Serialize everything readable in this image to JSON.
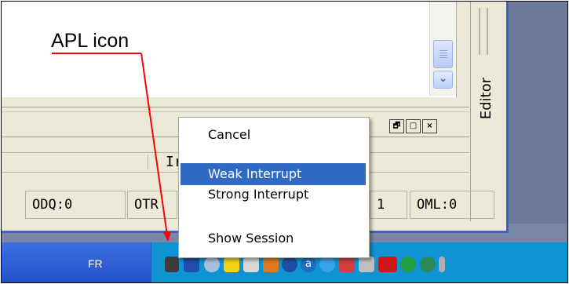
{
  "annotation": {
    "label": "APL icon",
    "color": "#ff0000"
  },
  "editor_tab": {
    "label": "Editor"
  },
  "pane_buttons": [
    "🗗",
    "□",
    "×"
  ],
  "input_row": {
    "text": "Ir"
  },
  "status_cells": [
    "ODQ:0",
    "OTR",
    "1",
    "OML:0"
  ],
  "context_menu": {
    "items": [
      {
        "label": "Cancel",
        "highlighted": false
      },
      {
        "label": "Weak Interrupt",
        "highlighted": true
      },
      {
        "label": "Strong Interrupt",
        "highlighted": false
      },
      {
        "label": "Show Session",
        "highlighted": false
      }
    ]
  },
  "taskbar": {
    "language": "FR"
  },
  "tray_icons": [
    "apl-icon",
    "network-icon",
    "cloud-icon",
    "warning-icon",
    "cross-icon",
    "office-icon",
    "info-icon",
    "a-icon",
    "search-icon",
    "flag-icon",
    "printer-icon",
    "ati-icon",
    "wifi-icon",
    "globe-icon"
  ],
  "colors": {
    "taskbar": "#2350c7",
    "tray": "#0f93d3",
    "menu_highlight": "#316ac5"
  }
}
